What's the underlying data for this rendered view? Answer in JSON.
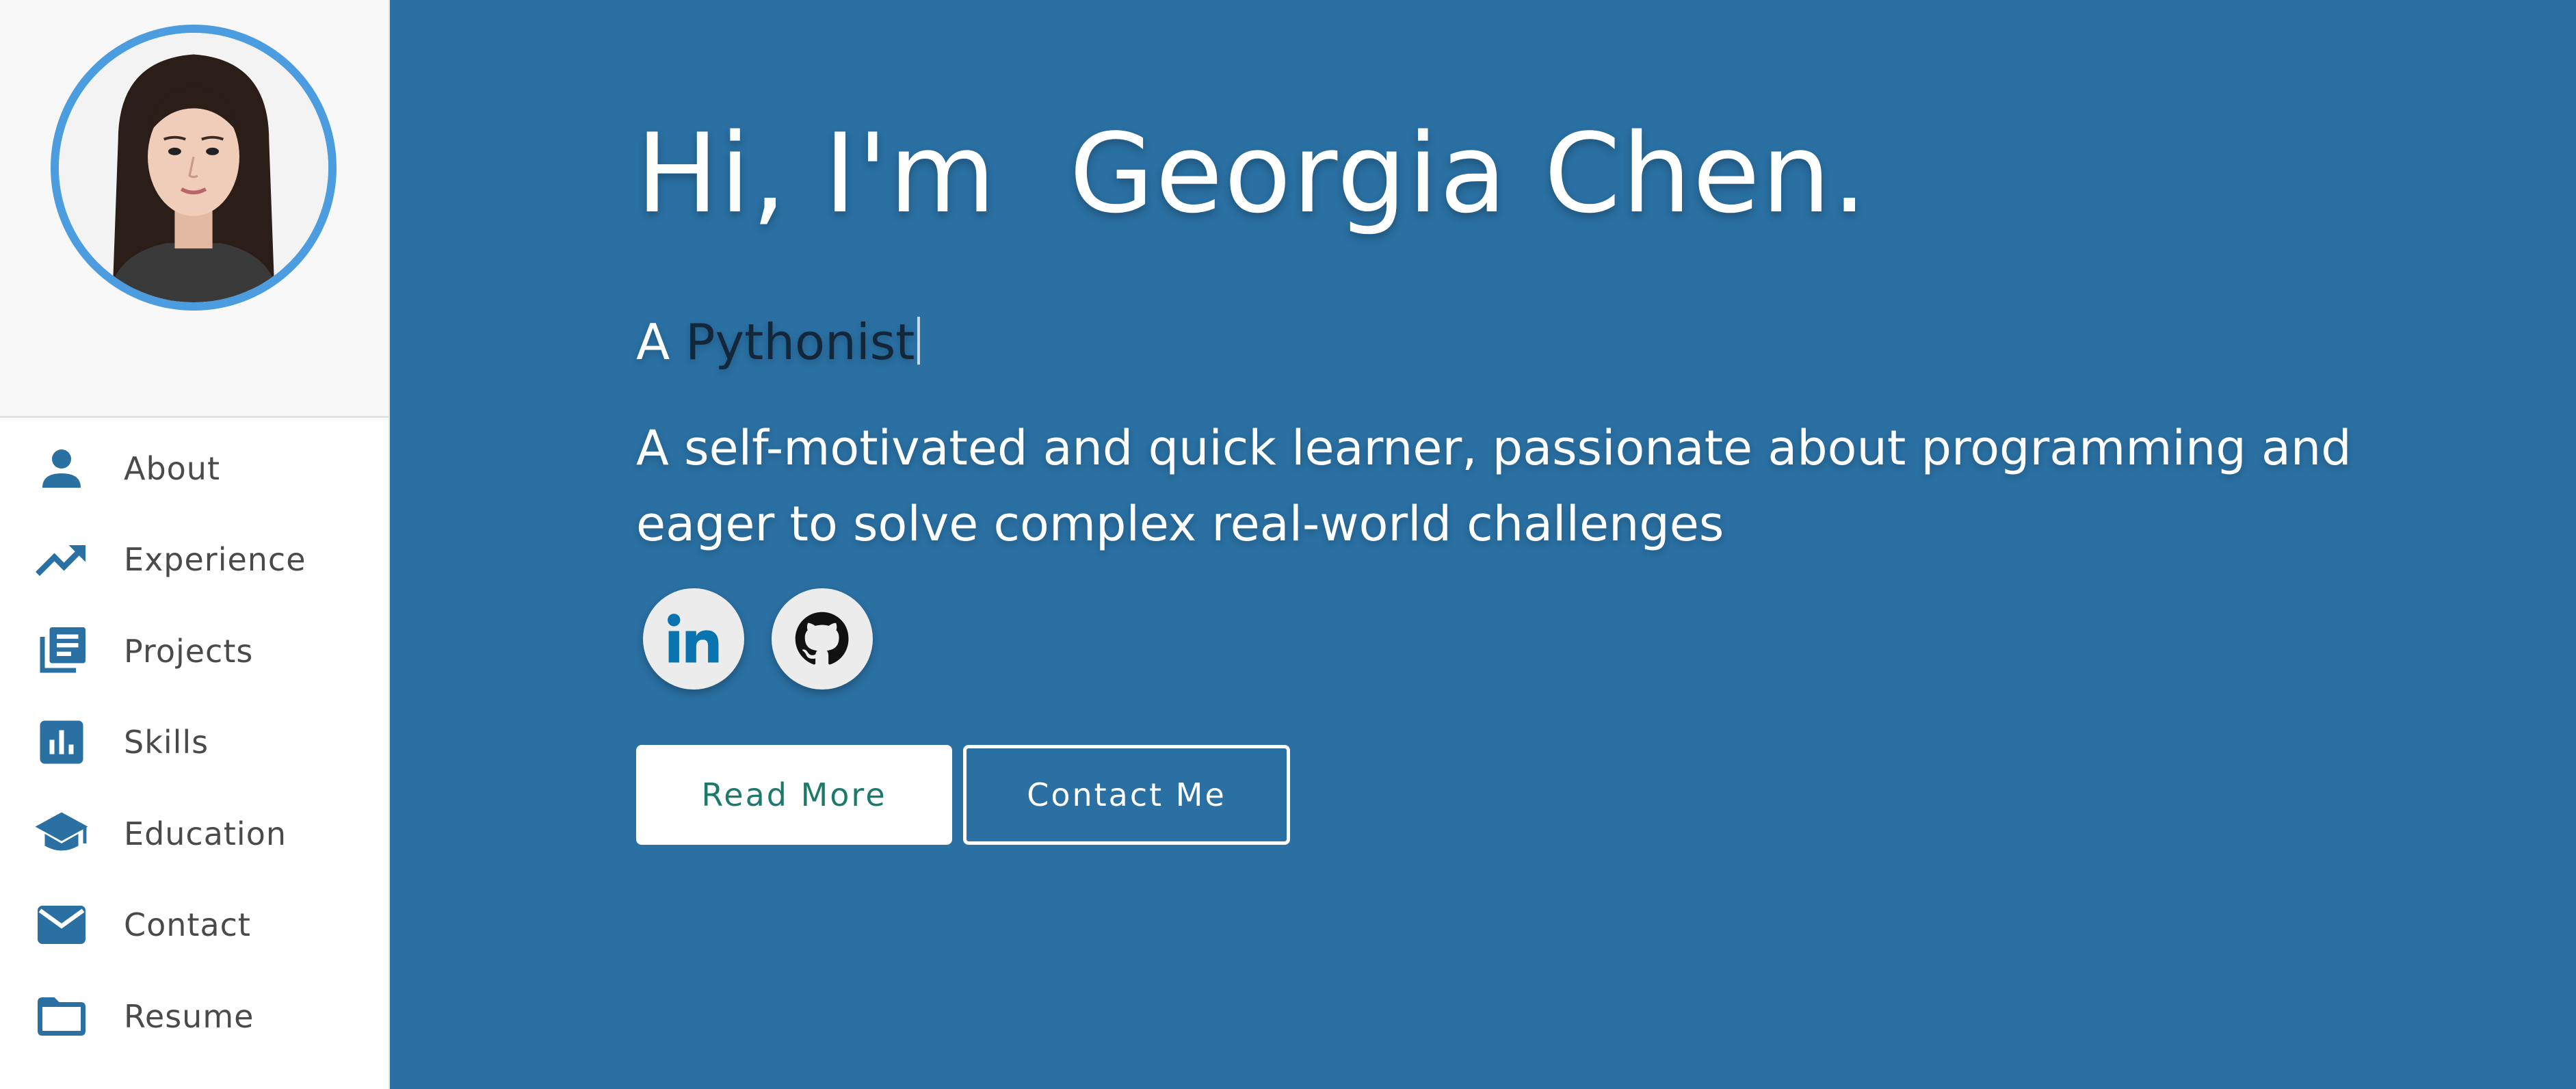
{
  "sidebar": {
    "avatar_alt": "Georgia Chen profile photo",
    "items": [
      {
        "label": "About",
        "icon": "person-icon"
      },
      {
        "label": "Experience",
        "icon": "trending-up-icon"
      },
      {
        "label": "Projects",
        "icon": "library-books-icon"
      },
      {
        "label": "Skills",
        "icon": "bar-chart-icon"
      },
      {
        "label": "Education",
        "icon": "graduation-cap-icon"
      },
      {
        "label": "Contact",
        "icon": "envelope-icon"
      },
      {
        "label": "Resume",
        "icon": "folder-icon"
      }
    ]
  },
  "hero": {
    "title": "Hi, I'm  Georgia Chen.",
    "tagline_prefix": "A ",
    "tagline_typed": "Pythonist",
    "description": "A self-motivated and quick learner, passionate about programming and eager to solve complex real-world challenges",
    "socials": [
      {
        "name": "LinkedIn",
        "icon": "linkedin-icon"
      },
      {
        "name": "GitHub",
        "icon": "github-icon"
      }
    ],
    "read_more_label": "Read More",
    "contact_me_label": "Contact Me"
  },
  "colors": {
    "hero_background": "#2a70a3",
    "sidebar_background": "#ffffff",
    "avatar_ring": "#4c9ddf",
    "icon_blue": "#2a70a3",
    "read_more_text": "#1d7a6a",
    "linkedin_blue": "#0a74b0"
  }
}
